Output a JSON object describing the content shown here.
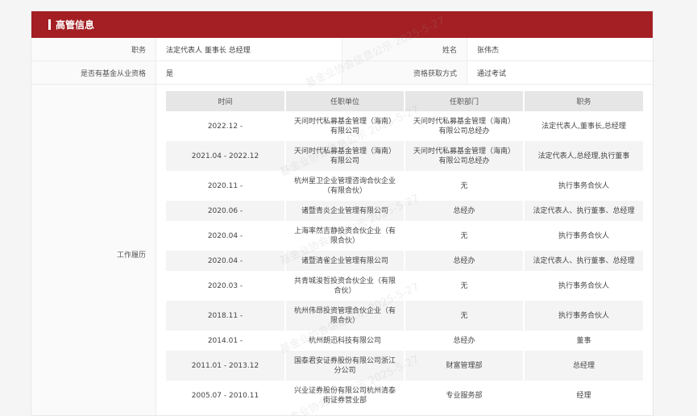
{
  "section": {
    "title": "高管信息"
  },
  "profile": {
    "position_label": "职务",
    "position_value": "法定代表人 董事长 总经理",
    "name_label": "姓名",
    "name_value": "张伟杰",
    "fund_label": "是否有基金从业资格",
    "fund_value": "是",
    "qualification_label": "资格获取方式",
    "qualification_value": "通过考试"
  },
  "resume": {
    "label": "工作履历",
    "headers": [
      "时间",
      "任职单位",
      "任职部门",
      "职务"
    ],
    "rows": [
      [
        "2022.12 -",
        "天问时代私募基金管理（海南）有限公司",
        "天问时代私募基金管理（海南）有限公司总经办",
        "法定代表人,董事长,总经理"
      ],
      [
        "2021.04 - 2022.12",
        "天问时代私募基金管理（海南）有限公司",
        "天问时代私募基金管理（海南）有限公司总经办",
        "法定代表人,总经理,执行董事"
      ],
      [
        "2020.11 -",
        "杭州星卫企业管理咨询合伙企业（有限合伙）",
        "无",
        "执行事务合伙人"
      ],
      [
        "2020.06 -",
        "诸暨青炎企业管理有限公司",
        "总经办",
        "法定代表人、执行董事、总经理"
      ],
      [
        "2020.04 -",
        "上海率然吉静投资合伙企业（有限合伙）",
        "无",
        "执行事务合伙人"
      ],
      [
        "2020.04 -",
        "诸暨清雀企业管理有限公司",
        "总经办",
        "法定代表人、执行董事、总经理"
      ],
      [
        "2020.03 -",
        "共青城浚哲投资合伙企业（有限合伙）",
        "无",
        "执行事务合伙人"
      ],
      [
        "2018.11 -",
        "杭州伟昂投资管理合伙企业（有限合伙）",
        "无",
        "执行事务合伙人"
      ],
      [
        "2014.01 -",
        "杭州朗迅科技有限公司",
        "总经办",
        "董事"
      ],
      [
        "2011.01 - 2013.12",
        "国泰君安证券股份有限公司浙江分公司",
        "财富管理部",
        "总经理"
      ],
      [
        "2005.07 - 2010.11",
        "兴业证券股份有限公司杭州清泰街证券营业部",
        "专业服务部",
        "经理"
      ]
    ]
  },
  "watermark": "基金业协会信息公示 2025-5-27",
  "colors": {
    "header_red": "#a31f23"
  }
}
